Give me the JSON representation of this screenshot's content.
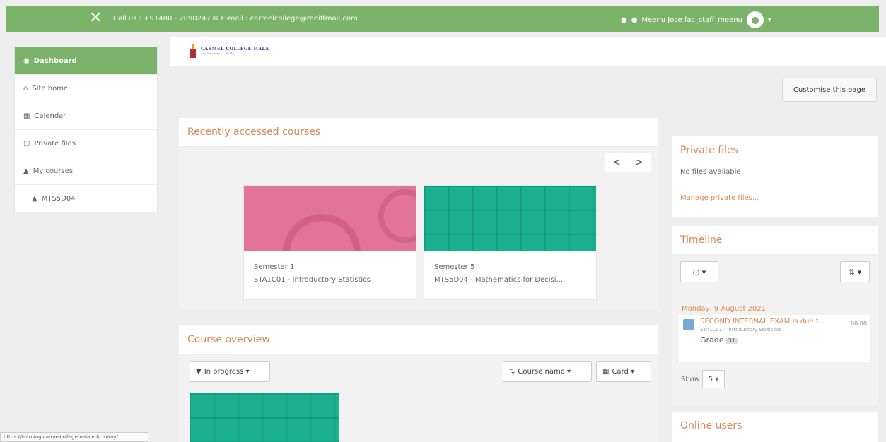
{
  "topbar": {
    "close_glyph": "✕",
    "contact": "Call us : +91480 - 2890247 ✉ E-mail : carmelcollege@rediffmail.com",
    "user": "Meenu Jose fac_staff_meenu"
  },
  "nav": {
    "items": [
      {
        "icon": "dashboard-icon",
        "glyph": "◉",
        "label": "Dashboard"
      },
      {
        "icon": "home-icon",
        "glyph": "⌂",
        "label": "Site home"
      },
      {
        "icon": "calendar-icon",
        "glyph": "▦",
        "label": "Calendar"
      },
      {
        "icon": "file-icon",
        "glyph": "▢",
        "label": "Private files"
      },
      {
        "icon": "graduation-cap-icon",
        "glyph": "▲",
        "label": "My courses"
      },
      {
        "icon": "graduation-cap-icon",
        "glyph": "▲",
        "label": "MTS5D04"
      }
    ]
  },
  "logo": {
    "name": "CARMEL COLLEGE MALA",
    "subtitle": "Autonomous · Mala"
  },
  "customise_label": "Customise this page",
  "recent": {
    "title": "Recently accessed courses",
    "prev": "<",
    "next": ">",
    "courses": [
      {
        "category": "Semester 1",
        "name": "STA1C01 - Introductory Statistics",
        "theme": "pink"
      },
      {
        "category": "Semester 5",
        "name": "MTS5D04 - Mathematics for Decisi...",
        "theme": "teal"
      }
    ]
  },
  "overview": {
    "title": "Course overview",
    "filter": "In progress ▾",
    "sort": "Course name ▾",
    "view": "Card ▾"
  },
  "private_files": {
    "title": "Private files",
    "empty": "No files available",
    "manage": "Manage private files..."
  },
  "timeline": {
    "title": "Timeline",
    "filter": "◷ ▾",
    "sort": "⇅ ▾",
    "date": "Monday, 9 August 2021",
    "event_title": "SECOND INTERNAL EXAM is due f...",
    "event_time": "00:00",
    "event_course": "STA1C01 - Introductory Statistics",
    "event_action": "Grade",
    "event_count": "31",
    "show_label": "Show",
    "show_value": "5 ▾"
  },
  "online_users": {
    "title": "Online users"
  },
  "status_url": "https://learning.carmelcollegemala.edu.in/my/"
}
